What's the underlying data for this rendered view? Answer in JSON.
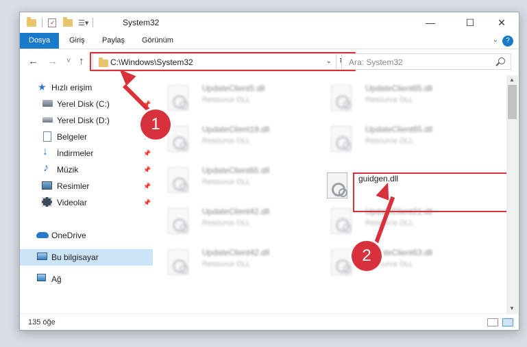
{
  "window": {
    "title": "System32",
    "minimize_label": "—",
    "maximize_label": "☐",
    "close_label": "✕"
  },
  "ribbon": {
    "tabs": [
      {
        "label": "Dosya",
        "active": true
      },
      {
        "label": "Giriş"
      },
      {
        "label": "Paylaş"
      },
      {
        "label": "Görünüm"
      }
    ],
    "help_label": "?",
    "collapse_label": "⌄"
  },
  "nav": {
    "back": "←",
    "forward": "→",
    "recent": "˅",
    "up": "↑",
    "address": "C:\\Windows\\System32",
    "address_dropdown": "⌄",
    "refresh": "↻",
    "search_placeholder": "Ara: System32"
  },
  "sidebar": {
    "items": [
      {
        "label": "Hızlı erişim",
        "icon": "star-icon"
      },
      {
        "label": "Yerel Disk (C:)",
        "icon": "drive-icon",
        "pinned": true
      },
      {
        "label": "Yerel Disk (D:)",
        "icon": "drive-icon",
        "pinned": true
      },
      {
        "label": "Belgeler",
        "icon": "documents-icon",
        "pinned": true
      },
      {
        "label": "İndirmeler",
        "icon": "download-icon",
        "pinned": true
      },
      {
        "label": "Müzik",
        "icon": "music-icon",
        "pinned": true
      },
      {
        "label": "Resimler",
        "icon": "pictures-icon",
        "pinned": true
      },
      {
        "label": "Videolar",
        "icon": "videos-icon",
        "pinned": true
      },
      {
        "label": "OneDrive",
        "icon": "cloud-icon"
      },
      {
        "label": "Bu bilgisayar",
        "icon": "computer-icon",
        "selected": true
      },
      {
        "label": "Ağ",
        "icon": "network-icon"
      }
    ]
  },
  "files": {
    "left": [
      {
        "name": "UpdateClient5.dll",
        "desc": "Resource DLL"
      },
      {
        "name": "UpdateClient19.dll",
        "desc": "Resource DLL"
      },
      {
        "name": "UpdateClient65.dll",
        "desc": "Resource DLL"
      },
      {
        "name": "UpdateClient42.dll",
        "desc": "Resource DLL"
      },
      {
        "name": "UpdateClient42.dll",
        "desc": "Resource DLL"
      }
    ],
    "right": [
      {
        "name": "UpdateClient65.dll",
        "desc": "Resource DLL"
      },
      {
        "name": "UpdateClient65.dll",
        "desc": "Resource DLL"
      },
      {
        "name": "guidgen.dll",
        "desc": "",
        "highlighted": true
      },
      {
        "name": "UpdateClient21.dll",
        "desc": "Resource DLL"
      },
      {
        "name": "UpdateClient63.dll",
        "desc": "Resource DLL"
      }
    ]
  },
  "status": {
    "item_count": "135 öğe"
  },
  "callouts": {
    "step1": "1",
    "step2": "2"
  },
  "colors": {
    "accent": "#1979ca",
    "highlight": "#d7313c",
    "selected_bg": "#cce4f7"
  }
}
